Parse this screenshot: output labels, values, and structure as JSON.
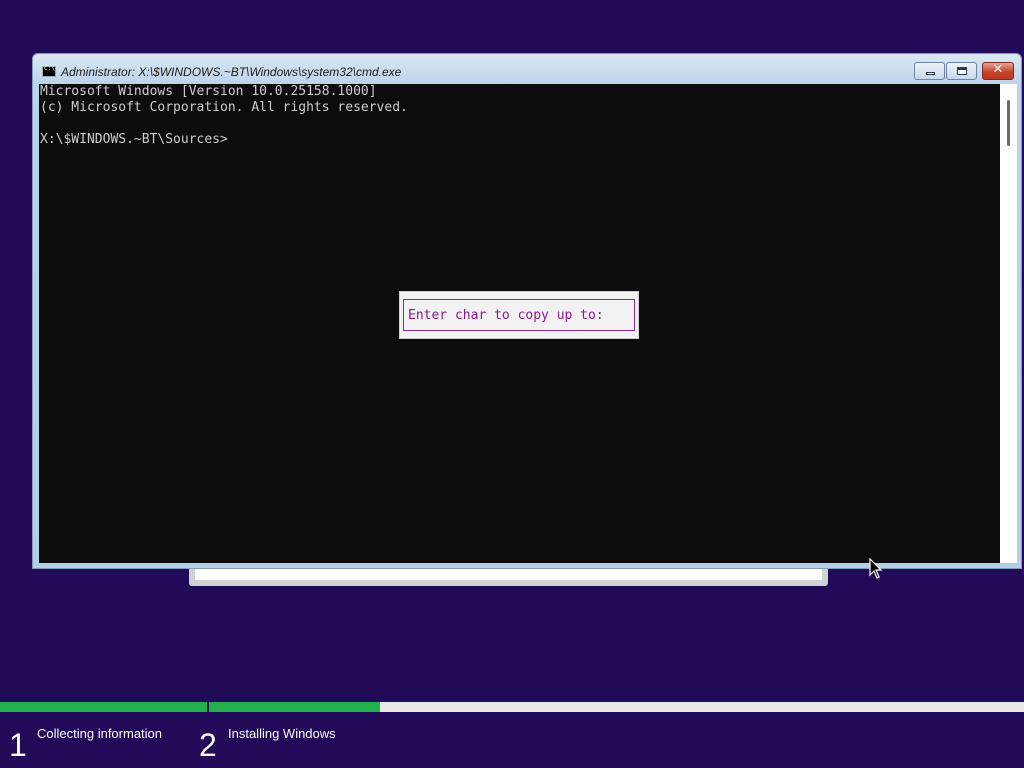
{
  "window": {
    "title": "Administrator: X:\\$WINDOWS.~BT\\Windows\\system32\\cmd.exe",
    "icon": "cmd-icon",
    "buttons": {
      "minimize_icon": "minimize-icon",
      "maximize_icon": "maximize-icon",
      "close_icon": "close-icon",
      "close_glyph": "✕"
    }
  },
  "console": {
    "lines": [
      "Microsoft Windows [Version 10.0.25158.1000]",
      "(c) Microsoft Corporation. All rights reserved.",
      "",
      "X:\\$WINDOWS.~BT\\Sources>"
    ]
  },
  "popup": {
    "prompt": "Enter char to copy up to:"
  },
  "progress": {
    "segments": [
      {
        "step": "1",
        "label": "Collecting information",
        "fill_fraction": 1.0
      },
      {
        "step": "2",
        "label": "Installing Windows",
        "fill_fraction": 0.21
      }
    ],
    "fill_color": "#22b14c",
    "track_color": "#e8e8e8"
  },
  "colors": {
    "background": "#210a57",
    "console_bg": "#0c0c0c",
    "console_text": "#cccccc",
    "popup_text": "#8b1b8b"
  }
}
